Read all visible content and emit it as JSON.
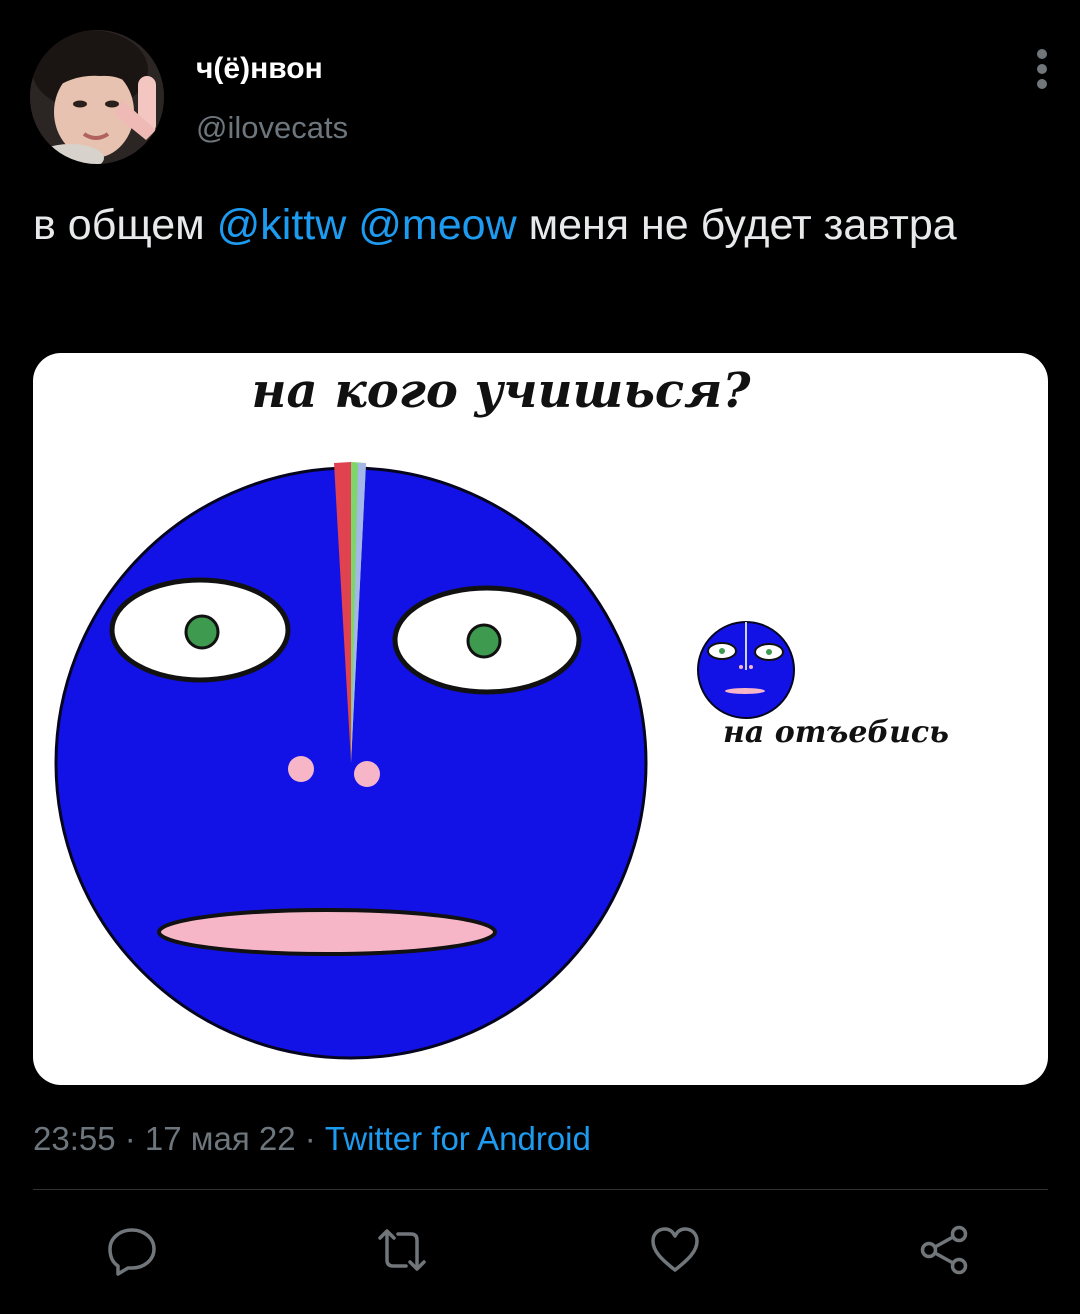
{
  "tweet": {
    "display_name": "ч(ё)нвон",
    "handle": "@ilovecats",
    "text_parts": {
      "prefix": "в общем ",
      "mention1": "@kittw",
      "space": " ",
      "mention2": "@meow",
      "suffix": " меня не будет завтра"
    },
    "media": {
      "title": "на кого учишься?",
      "caption": "на отъебись"
    },
    "meta": {
      "time": "23:55",
      "separator": " · ",
      "date": "17 мая 22",
      "source": "Twitter for Android"
    }
  },
  "icons": {
    "more": "more-vertical-icon",
    "reply": "reply-icon",
    "retweet": "retweet-icon",
    "like": "heart-icon",
    "share": "share-icon"
  },
  "colors": {
    "background": "#000000",
    "text": "#e7e9ea",
    "muted": "#6e767d",
    "accent": "#1d9bf0",
    "face_blue": "#1212e6"
  }
}
